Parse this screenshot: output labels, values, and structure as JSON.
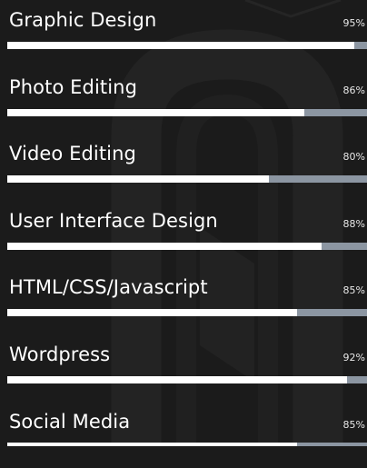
{
  "skills": [
    {
      "name": "Graphic Design",
      "percent_label": "95%",
      "level": 0.965
    },
    {
      "name": "Photo Editing",
      "percent_label": "86%",
      "level": 0.825
    },
    {
      "name": "Video Editing",
      "percent_label": "80%",
      "level": 0.727
    },
    {
      "name": "User Interface Design",
      "percent_label": "88%",
      "level": 0.874
    },
    {
      "name": "HTML/CSS/Javascript",
      "percent_label": "85%",
      "level": 0.805
    },
    {
      "name": "Wordpress",
      "percent_label": "92%",
      "level": 0.945
    },
    {
      "name": "Social Media",
      "percent_label": "85%",
      "level": 0.805
    }
  ],
  "colors": {
    "background": "#1b1b1b",
    "bar_fill": "#ffffff",
    "bar_track": "#8c96a2",
    "text": "#ffffff"
  }
}
